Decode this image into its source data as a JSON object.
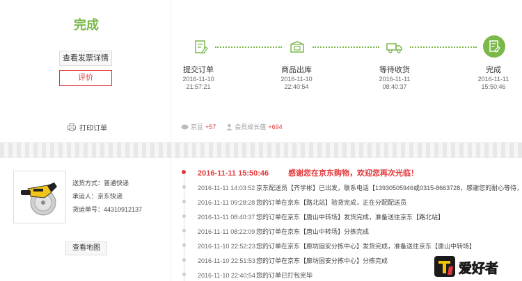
{
  "status": {
    "title": "完成",
    "invoice_button": "查看发票详情",
    "review_button": "评价",
    "print_label": "打印订单"
  },
  "progress": {
    "steps": [
      {
        "label": "提交订单",
        "date": "2016-11-10",
        "time": "21:57:21",
        "icon": "submit-order-icon"
      },
      {
        "label": "商品出库",
        "date": "2016-11-10",
        "time": "22:40:54",
        "icon": "package-icon"
      },
      {
        "label": "等待收货",
        "date": "2016-11-11",
        "time": "08:40:37",
        "icon": "truck-icon"
      },
      {
        "label": "完成",
        "date": "2016-11-11",
        "time": "15:50:46",
        "icon": "done-icon"
      }
    ],
    "beans_label": "京豆",
    "beans_value": "+57",
    "growth_label": "会员成长值",
    "growth_value": "+694"
  },
  "shipping": {
    "method": "送货方式：普通快递",
    "carrier": "承运人：京东快递",
    "tracking": "货运单号：44310912137",
    "map_button": "查看地图"
  },
  "tracking": [
    {
      "time": "2016-11-11 15:50:46",
      "text": "感谢您在京东购物，欢迎您再次光临！"
    },
    {
      "time": "2016-11-11 14:03:52",
      "text": "京东配送员【齐学彬】已出发，联系电话【13930505946或0315-8663728，感谢您的耐心等待，参加"
    },
    {
      "time": "2016-11-11 09:28:28",
      "text": "您的订单在京东【路北站】验货完成，正在分配配送员"
    },
    {
      "time": "2016-11-11 08:40:37",
      "text": "您的订单在京东【唐山中转场】发货完成，准备送往京东【路北站】"
    },
    {
      "time": "2016-11-11 08:22:09",
      "text": "您的订单在京东【唐山中转场】分拣完成"
    },
    {
      "time": "2016-11-10 22:52:23",
      "text": "您的订单在京东【廊坊固安分拣中心】发货完成，准备送往京东【唐山中转场】"
    },
    {
      "time": "2016-11-10 22:51:53",
      "text": "您的订单在京东【廊坊固安分拣中心】分拣完成"
    },
    {
      "time": "2016-11-10 22:40:54",
      "text": "您的订单已打包完毕"
    }
  ],
  "watermark": {
    "text": "爱好者"
  },
  "colors": {
    "accent": "#7ab84a",
    "alert": "#e4393c"
  }
}
